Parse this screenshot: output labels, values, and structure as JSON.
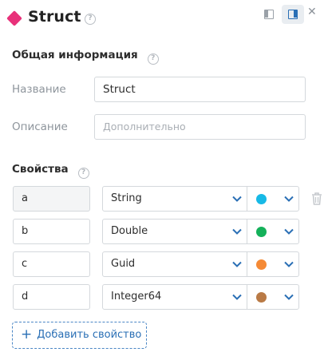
{
  "header": {
    "title": "Struct",
    "help_icon": "question-circle-icon",
    "layout_left_icon": "panel-left-icon",
    "layout_right_icon": "panel-right-icon",
    "close_icon": "close-icon",
    "diamond_color": "#e8317a"
  },
  "general": {
    "heading": "Общая информация",
    "name_label": "Название",
    "name_value": "Struct",
    "desc_label": "Описание",
    "desc_placeholder": "Дополнительно"
  },
  "properties": {
    "heading": "Свойства",
    "items": [
      {
        "name": "a",
        "type": "String",
        "color": "#17b9e6"
      },
      {
        "name": "b",
        "type": "Double",
        "color": "#14b15a"
      },
      {
        "name": "c",
        "type": "Guid",
        "color": "#f58a36"
      },
      {
        "name": "d",
        "type": "Integer64",
        "color": "#b97a45"
      }
    ],
    "add_label": "Добавить свойство"
  },
  "colors": {
    "accent": "#2a6fb5"
  }
}
